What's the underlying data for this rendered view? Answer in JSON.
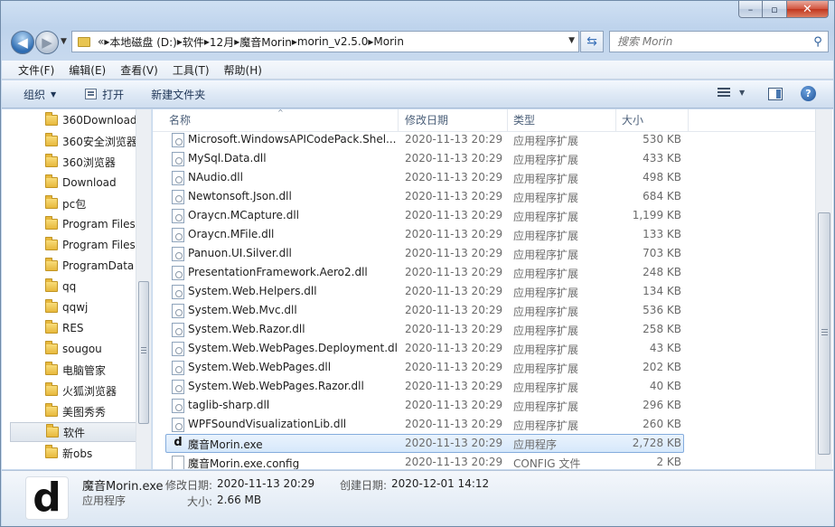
{
  "window": {
    "caption": {
      "minimize": "–",
      "maximize": "▫",
      "close": "✕"
    }
  },
  "navigation": {
    "back_glyph": "◀",
    "forward_glyph": "▶",
    "address": {
      "overflow": "«",
      "crumbs": [
        "本地磁盘 (D:)",
        "软件",
        "12月",
        "魔音Morin",
        "morin_v2.5.0",
        "Morin"
      ]
    },
    "refresh_glyph": "⇆",
    "search_placeholder": "搜索 Morin"
  },
  "menu": [
    "文件(F)",
    "编辑(E)",
    "查看(V)",
    "工具(T)",
    "帮助(H)"
  ],
  "commands": {
    "organize": "组织",
    "open": "打开",
    "new_folder": "新建文件夹",
    "help": "?"
  },
  "nav_tree": [
    "360Download",
    "360安全浏览器",
    "360浏览器",
    "Download",
    "pc包",
    "Program Files",
    "Program Files",
    "ProgramData",
    "qq",
    "qqwj",
    "RES",
    "sougou",
    "电脑管家",
    "火狐浏览器",
    "美图秀秀",
    "软件",
    "新obs"
  ],
  "nav_selected_index": 15,
  "columns": {
    "name": "名称",
    "date": "修改日期",
    "type": "类型",
    "size": "大小"
  },
  "files": [
    {
      "name": "Microsoft.WindowsAPICodePack.Shel...",
      "date": "2020-11-13 20:29",
      "type": "应用程序扩展",
      "size": "530 KB",
      "icon": "dll-icon"
    },
    {
      "name": "MySql.Data.dll",
      "date": "2020-11-13 20:29",
      "type": "应用程序扩展",
      "size": "433 KB",
      "icon": "dll-icon"
    },
    {
      "name": "NAudio.dll",
      "date": "2020-11-13 20:29",
      "type": "应用程序扩展",
      "size": "498 KB",
      "icon": "dll-icon"
    },
    {
      "name": "Newtonsoft.Json.dll",
      "date": "2020-11-13 20:29",
      "type": "应用程序扩展",
      "size": "684 KB",
      "icon": "dll-icon"
    },
    {
      "name": "Oraycn.MCapture.dll",
      "date": "2020-11-13 20:29",
      "type": "应用程序扩展",
      "size": "1,199 KB",
      "icon": "dll-icon"
    },
    {
      "name": "Oraycn.MFile.dll",
      "date": "2020-11-13 20:29",
      "type": "应用程序扩展",
      "size": "133 KB",
      "icon": "dll-icon"
    },
    {
      "name": "Panuon.UI.Silver.dll",
      "date": "2020-11-13 20:29",
      "type": "应用程序扩展",
      "size": "703 KB",
      "icon": "dll-icon"
    },
    {
      "name": "PresentationFramework.Aero2.dll",
      "date": "2020-11-13 20:29",
      "type": "应用程序扩展",
      "size": "248 KB",
      "icon": "dll-icon"
    },
    {
      "name": "System.Web.Helpers.dll",
      "date": "2020-11-13 20:29",
      "type": "应用程序扩展",
      "size": "134 KB",
      "icon": "dll-icon"
    },
    {
      "name": "System.Web.Mvc.dll",
      "date": "2020-11-13 20:29",
      "type": "应用程序扩展",
      "size": "536 KB",
      "icon": "dll-icon"
    },
    {
      "name": "System.Web.Razor.dll",
      "date": "2020-11-13 20:29",
      "type": "应用程序扩展",
      "size": "258 KB",
      "icon": "dll-icon"
    },
    {
      "name": "System.Web.WebPages.Deployment.dll",
      "date": "2020-11-13 20:29",
      "type": "应用程序扩展",
      "size": "43 KB",
      "icon": "dll-icon"
    },
    {
      "name": "System.Web.WebPages.dll",
      "date": "2020-11-13 20:29",
      "type": "应用程序扩展",
      "size": "202 KB",
      "icon": "dll-icon"
    },
    {
      "name": "System.Web.WebPages.Razor.dll",
      "date": "2020-11-13 20:29",
      "type": "应用程序扩展",
      "size": "40 KB",
      "icon": "dll-icon"
    },
    {
      "name": "taglib-sharp.dll",
      "date": "2020-11-13 20:29",
      "type": "应用程序扩展",
      "size": "296 KB",
      "icon": "dll-icon"
    },
    {
      "name": "WPFSoundVisualizationLib.dll",
      "date": "2020-11-13 20:29",
      "type": "应用程序扩展",
      "size": "260 KB",
      "icon": "dll-icon"
    },
    {
      "name": "魔音Morin.exe",
      "date": "2020-11-13 20:29",
      "type": "应用程序",
      "size": "2,728 KB",
      "icon": "morin-app-icon"
    },
    {
      "name": "魔音Morin.exe.config",
      "date": "2020-11-13 20:29",
      "type": "CONFIG 文件",
      "size": "2 KB",
      "icon": "config-file-icon"
    }
  ],
  "selected_file_index": 16,
  "exe_glyph": "d",
  "details": {
    "name": "魔音Morin.exe",
    "type": "应用程序",
    "modified_label": "修改日期:",
    "modified_value": "2020-11-13 20:29",
    "created_label": "创建日期:",
    "created_value": "2020-12-01 14:12",
    "size_label": "大小:",
    "size_value": "2.66 MB",
    "thumb_glyph": "d"
  },
  "colors": {
    "selection_border": "#84acdd",
    "selection_fill": "#d6e8fb",
    "folder": "#e7b83c"
  }
}
